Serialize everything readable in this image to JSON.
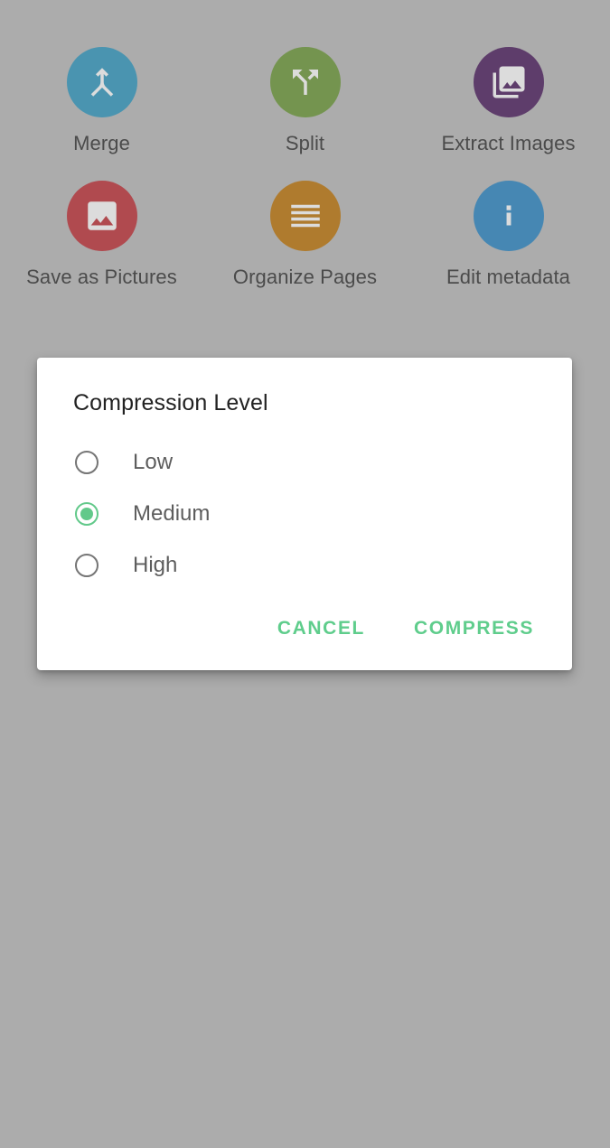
{
  "screen": {
    "background_color": "#acacac"
  },
  "tool_grid": {
    "items": [
      {
        "label": "Merge",
        "icon": "merge-icon",
        "circle_color": "#4a94b0"
      },
      {
        "label": "Split",
        "icon": "call-split-icon",
        "circle_color": "#74944f"
      },
      {
        "label": "Extract Images",
        "icon": "photo-library-icon",
        "circle_color": "#5e3d6b"
      },
      {
        "label": "Save as Pictures",
        "icon": "image-icon",
        "circle_color": "#b04a4f"
      },
      {
        "label": "Organize Pages",
        "icon": "reorder-icon",
        "circle_color": "#af7b2e"
      },
      {
        "label": "Edit metadata",
        "icon": "info-icon",
        "circle_color": "#4687b3"
      }
    ]
  },
  "dialog": {
    "title": "Compression Level",
    "accent_color": "#5fcd8c",
    "options": [
      {
        "label": "Low",
        "selected": false
      },
      {
        "label": "Medium",
        "selected": true
      },
      {
        "label": "High",
        "selected": false
      }
    ],
    "actions": {
      "cancel_label": "CANCEL",
      "confirm_label": "COMPRESS"
    }
  }
}
